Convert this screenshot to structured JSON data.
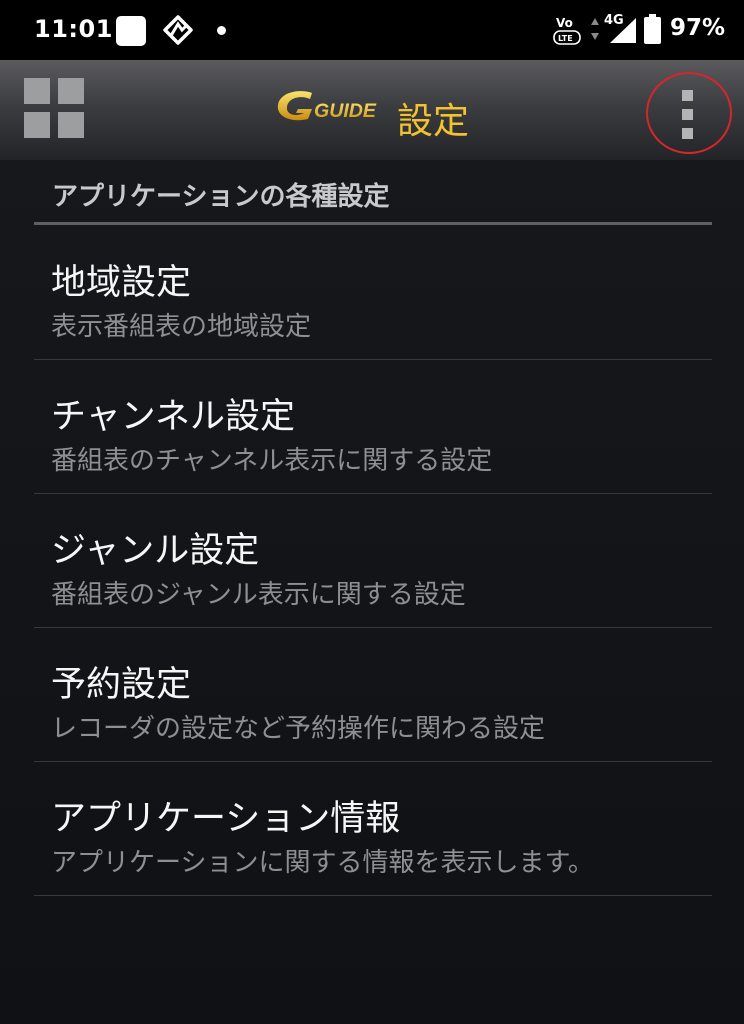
{
  "status_bar": {
    "time": "11:01",
    "network": "4G",
    "battery": "97%",
    "icons": [
      "notification-square-icon",
      "sync-icon",
      "notification-dot-icon",
      "volte-icon",
      "data-arrows-icon",
      "signal-icon",
      "battery-icon"
    ]
  },
  "app_bar": {
    "logo_text": "GUIDE",
    "title": "設定",
    "left_icon": "grid-menu-icon",
    "right_icon": "overflow-menu-icon",
    "highlight_color": "#d6262b",
    "accent_color": "#f2c230"
  },
  "section": {
    "header": "アプリケーションの各種設定"
  },
  "settings": {
    "items": [
      {
        "title": "地域設定",
        "subtitle": "表示番組表の地域設定"
      },
      {
        "title": "チャンネル設定",
        "subtitle": "番組表のチャンネル表示に関する設定"
      },
      {
        "title": "ジャンル設定",
        "subtitle": "番組表のジャンル表示に関する設定"
      },
      {
        "title": "予約設定",
        "subtitle": "レコーダの設定など予約操作に関わる設定"
      },
      {
        "title": "アプリケーション情報",
        "subtitle": "アプリケーションに関する情報を表示します。"
      }
    ]
  }
}
